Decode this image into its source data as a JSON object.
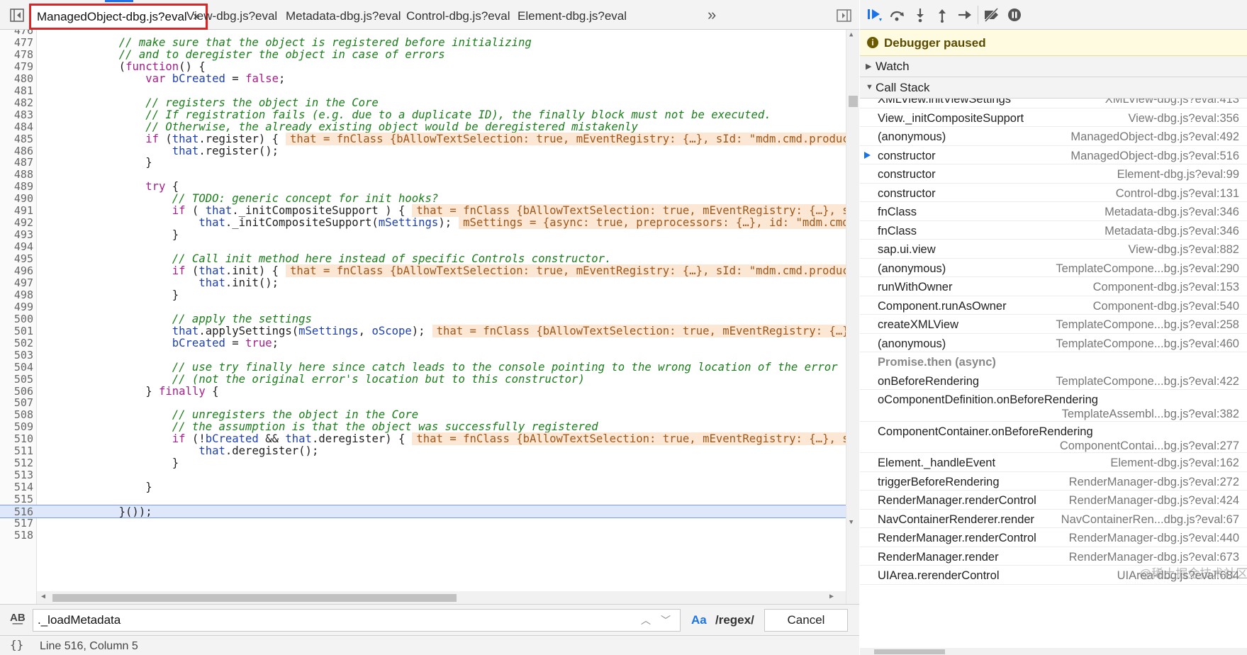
{
  "tabs": [
    {
      "label": "ManagedObject-dbg.js?eval",
      "active": true
    },
    {
      "label": "View-dbg.js?eval",
      "active": false
    },
    {
      "label": "Metadata-dbg.js?eval",
      "active": false
    },
    {
      "label": "Control-dbg.js?eval",
      "active": false
    },
    {
      "label": "Element-dbg.js?eval",
      "active": false
    }
  ],
  "more_tabs": "»",
  "close_glyph": "×",
  "code_lines": [
    {
      "n": "476",
      "html": ""
    },
    {
      "n": "477",
      "html": "            <span class='cm'>// make sure that the object is registered before initializing</span>"
    },
    {
      "n": "478",
      "html": "            <span class='cm'>// and to deregister the object in case of errors</span>"
    },
    {
      "n": "479",
      "html": "            (<span class='kw'>function</span>() {"
    },
    {
      "n": "480",
      "html": "                <span class='kw'>var</span> <span class='vr'>bCreated</span> = <span class='kw'>false</span>;"
    },
    {
      "n": "481",
      "html": ""
    },
    {
      "n": "482",
      "html": "                <span class='cm'>// registers the object in the Core</span>"
    },
    {
      "n": "483",
      "html": "                <span class='cm'>// If registration fails (e.g. due to a duplicate ID), the finally block must not be executed.</span>"
    },
    {
      "n": "484",
      "html": "                <span class='cm'>// Otherwise, the already existing object would be deregistered mistakenly</span>"
    },
    {
      "n": "485",
      "html": "                <span class='kw'>if</span> (<span class='vr'>that</span>.register) {<span class='inl'>that = fnClass {bAllowTextSelection: true, mEventRegistry: {…}, sId: \"mdm.cmd.product.m</span>"
    },
    {
      "n": "486",
      "html": "                    <span class='vr'>that</span>.register();"
    },
    {
      "n": "487",
      "html": "                }"
    },
    {
      "n": "488",
      "html": ""
    },
    {
      "n": "489",
      "html": "                <span class='kw'>try</span> {"
    },
    {
      "n": "490",
      "html": "                    <span class='cm'>// TODO: generic concept for init hooks?</span>"
    },
    {
      "n": "491",
      "html": "                    <span class='kw'>if</span> ( <span class='vr'>that</span>._initCompositeSupport ) {<span class='inl'>that = fnClass {bAllowTextSelection: true, mEventRegistry: {…}, sId:</span>"
    },
    {
      "n": "492",
      "html": "                        <span class='vr'>that</span>._initCompositeSupport(<span class='vr'>mSettings</span>);<span class='inl'>mSettings = {async: true, preprocessors: {…}, id: \"mdm.cmd.pr</span>"
    },
    {
      "n": "493",
      "html": "                    }"
    },
    {
      "n": "494",
      "html": ""
    },
    {
      "n": "495",
      "html": "                    <span class='cm'>// Call init method here instead of specific Controls constructor.</span>"
    },
    {
      "n": "496",
      "html": "                    <span class='kw'>if</span> (<span class='vr'>that</span>.init) {<span class='inl'>that = fnClass {bAllowTextSelection: true, mEventRegistry: {…}, sId: \"mdm.cmd.product.m</span>"
    },
    {
      "n": "497",
      "html": "                        <span class='vr'>that</span>.init();"
    },
    {
      "n": "498",
      "html": "                    }"
    },
    {
      "n": "499",
      "html": ""
    },
    {
      "n": "500",
      "html": "                    <span class='cm'>// apply the settings</span>"
    },
    {
      "n": "501",
      "html": "                    <span class='vr'>that</span>.applySettings(<span class='vr'>mSettings</span>, <span class='vr'>oScope</span>);<span class='inl'>that = fnClass {bAllowTextSelection: true, mEventRegistry: {…}, s</span>"
    },
    {
      "n": "502",
      "html": "                    <span class='vr'>bCreated</span> = <span class='kw'>true</span>;"
    },
    {
      "n": "503",
      "html": ""
    },
    {
      "n": "504",
      "html": "                    <span class='cm'>// use try finally here since catch leads to the console pointing to the wrong location of the error</span>"
    },
    {
      "n": "505",
      "html": "                    <span class='cm'>// (not the original error's location but to this constructor)</span>"
    },
    {
      "n": "506",
      "html": "                } <span class='kw'>finally</span> {"
    },
    {
      "n": "507",
      "html": ""
    },
    {
      "n": "508",
      "html": "                    <span class='cm'>// unregisters the object in the Core</span>"
    },
    {
      "n": "509",
      "html": "                    <span class='cm'>// the assumption is that the object was successfully registered</span>"
    },
    {
      "n": "510",
      "html": "                    <span class='kw'>if</span> (!<span class='vr'>bCreated</span> &amp;&amp; <span class='vr'>that</span>.deregister) {<span class='inl'>that = fnClass {bAllowTextSelection: true, mEventRegistry: {…}, sId:</span>"
    },
    {
      "n": "511",
      "html": "                        <span class='vr'>that</span>.deregister();"
    },
    {
      "n": "512",
      "html": "                    }"
    },
    {
      "n": "513",
      "html": ""
    },
    {
      "n": "514",
      "html": "                }"
    },
    {
      "n": "515",
      "html": ""
    },
    {
      "n": "516",
      "html": "            }());",
      "highlight": true
    },
    {
      "n": "517",
      "html": ""
    },
    {
      "n": "518",
      "html": ""
    }
  ],
  "search": {
    "value": "._loadMetadata",
    "case_label": "Aa",
    "regex_label": "/regex/",
    "cancel_label": "Cancel",
    "case_icon_text": "A͟B"
  },
  "status": {
    "braces": "{}",
    "position": "Line 516, Column 5"
  },
  "debugger": {
    "paused_text": "Debugger paused",
    "watch_label": "Watch",
    "callstack_label": "Call Stack",
    "frames": [
      {
        "fn": "XMLView.initViewSettings",
        "loc": "XMLView-dbg.js?eval:413"
      },
      {
        "fn": "View._initCompositeSupport",
        "loc": "View-dbg.js?eval:356"
      },
      {
        "fn": "(anonymous)",
        "loc": "ManagedObject-dbg.js?eval:492"
      },
      {
        "fn": "constructor",
        "loc": "ManagedObject-dbg.js?eval:516",
        "current": true
      },
      {
        "fn": "constructor",
        "loc": "Element-dbg.js?eval:99"
      },
      {
        "fn": "constructor",
        "loc": "Control-dbg.js?eval:131"
      },
      {
        "fn": "fnClass",
        "loc": "Metadata-dbg.js?eval:346"
      },
      {
        "fn": "fnClass",
        "loc": "Metadata-dbg.js?eval:346"
      },
      {
        "fn": "sap.ui.view",
        "loc": "View-dbg.js?eval:882"
      },
      {
        "fn": "(anonymous)",
        "loc": "TemplateCompone...bg.js?eval:290"
      },
      {
        "fn": "runWithOwner",
        "loc": "Component-dbg.js?eval:153"
      },
      {
        "fn": "Component.runAsOwner",
        "loc": "Component-dbg.js?eval:540"
      },
      {
        "fn": "createXMLView",
        "loc": "TemplateCompone...bg.js?eval:258"
      },
      {
        "fn": "(anonymous)",
        "loc": "TemplateCompone...bg.js?eval:460"
      },
      {
        "fn": "Promise.then (async)",
        "loc": "",
        "async": true
      },
      {
        "fn": "onBeforeRendering",
        "loc": "TemplateCompone...bg.js?eval:422"
      },
      {
        "fn": "oComponentDefinition.onBeforeRendering",
        "loc": "TemplateAssembl...bg.js?eval:382",
        "two": true
      },
      {
        "fn": "ComponentContainer.onBeforeRendering",
        "loc": "ComponentContai...bg.js?eval:277",
        "two": true
      },
      {
        "fn": "Element._handleEvent",
        "loc": "Element-dbg.js?eval:162"
      },
      {
        "fn": "triggerBeforeRendering",
        "loc": "RenderManager-dbg.js?eval:272"
      },
      {
        "fn": "RenderManager.renderControl",
        "loc": "RenderManager-dbg.js?eval:424"
      },
      {
        "fn": "NavContainerRenderer.render",
        "loc": "NavContainerRen...dbg.js?eval:67"
      },
      {
        "fn": "RenderManager.renderControl",
        "loc": "RenderManager-dbg.js?eval:440"
      },
      {
        "fn": "RenderManager.render",
        "loc": "RenderManager-dbg.js?eval:673"
      },
      {
        "fn": "UIArea.rerenderControl",
        "loc": "UIArea-dbg.js?eval:684"
      }
    ]
  },
  "watermark": "@稀土掘金技术社区",
  "colors": {
    "accent": "#1a73e8",
    "tab_outline": "#e02424",
    "paused_bg": "#fffbe0",
    "inline_value_bg": "#fbe7d4",
    "comment": "#1a7f1a",
    "keyword": "#a71d8a"
  }
}
